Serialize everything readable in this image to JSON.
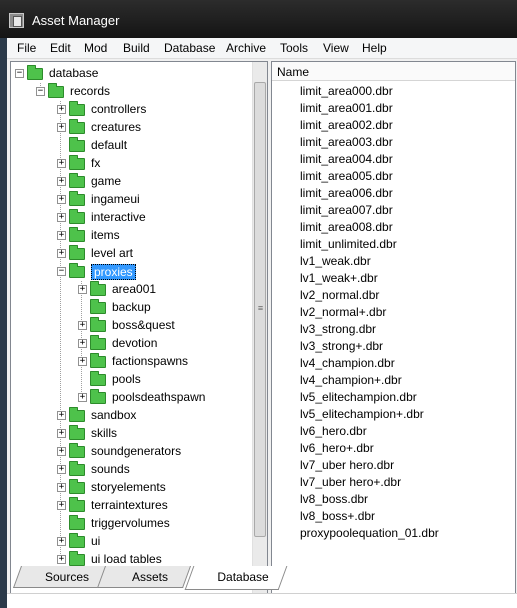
{
  "window": {
    "title": "Asset Manager"
  },
  "menu": [
    "File",
    "Edit",
    "Mod",
    "Build",
    "Database",
    "Archive",
    "Tools",
    "View",
    "Help"
  ],
  "tree": [
    {
      "label": "database",
      "expander": "−"
    },
    {
      "label": "records",
      "expander": "−"
    },
    {
      "label": "controllers",
      "expander": "+"
    },
    {
      "label": "creatures",
      "expander": "+"
    },
    {
      "label": "default",
      "expander": ""
    },
    {
      "label": "fx",
      "expander": "+"
    },
    {
      "label": "game",
      "expander": "+"
    },
    {
      "label": "ingameui",
      "expander": "+"
    },
    {
      "label": "interactive",
      "expander": "+"
    },
    {
      "label": "items",
      "expander": "+"
    },
    {
      "label": "level art",
      "expander": "+"
    },
    {
      "label": "proxies",
      "expander": "−"
    },
    {
      "label": "area001",
      "expander": "+"
    },
    {
      "label": "backup",
      "expander": ""
    },
    {
      "label": "boss&quest",
      "expander": "+"
    },
    {
      "label": "devotion",
      "expander": "+"
    },
    {
      "label": "factionspawns",
      "expander": "+"
    },
    {
      "label": "pools",
      "expander": ""
    },
    {
      "label": "poolsdeathspawn",
      "expander": "+"
    },
    {
      "label": "sandbox",
      "expander": "+"
    },
    {
      "label": "skills",
      "expander": "+"
    },
    {
      "label": "soundgenerators",
      "expander": "+"
    },
    {
      "label": "sounds",
      "expander": "+"
    },
    {
      "label": "storyelements",
      "expander": "+"
    },
    {
      "label": "terraintextures",
      "expander": "+"
    },
    {
      "label": "triggervolumes",
      "expander": ""
    },
    {
      "label": "ui",
      "expander": "+"
    },
    {
      "label": "ui load tables",
      "expander": "+"
    }
  ],
  "list": {
    "header": "Name",
    "files": [
      "limit_area000.dbr",
      "limit_area001.dbr",
      "limit_area002.dbr",
      "limit_area003.dbr",
      "limit_area004.dbr",
      "limit_area005.dbr",
      "limit_area006.dbr",
      "limit_area007.dbr",
      "limit_area008.dbr",
      "limit_unlimited.dbr",
      "lv1_weak.dbr",
      "lv1_weak+.dbr",
      "lv2_normal.dbr",
      "lv2_normal+.dbr",
      "lv3_strong.dbr",
      "lv3_strong+.dbr",
      "lv4_champion.dbr",
      "lv4_champion+.dbr",
      "lv5_elitechampion.dbr",
      "lv5_elitechampion+.dbr",
      "lv6_hero.dbr",
      "lv6_hero+.dbr",
      "lv7_uber hero.dbr",
      "lv7_uber hero+.dbr",
      "lv8_boss.dbr",
      "lv8_boss+.dbr",
      "proxypoolequation_01.dbr"
    ]
  },
  "scroll_grip": "≡",
  "tabs": [
    "Sources",
    "Assets",
    "Database"
  ]
}
